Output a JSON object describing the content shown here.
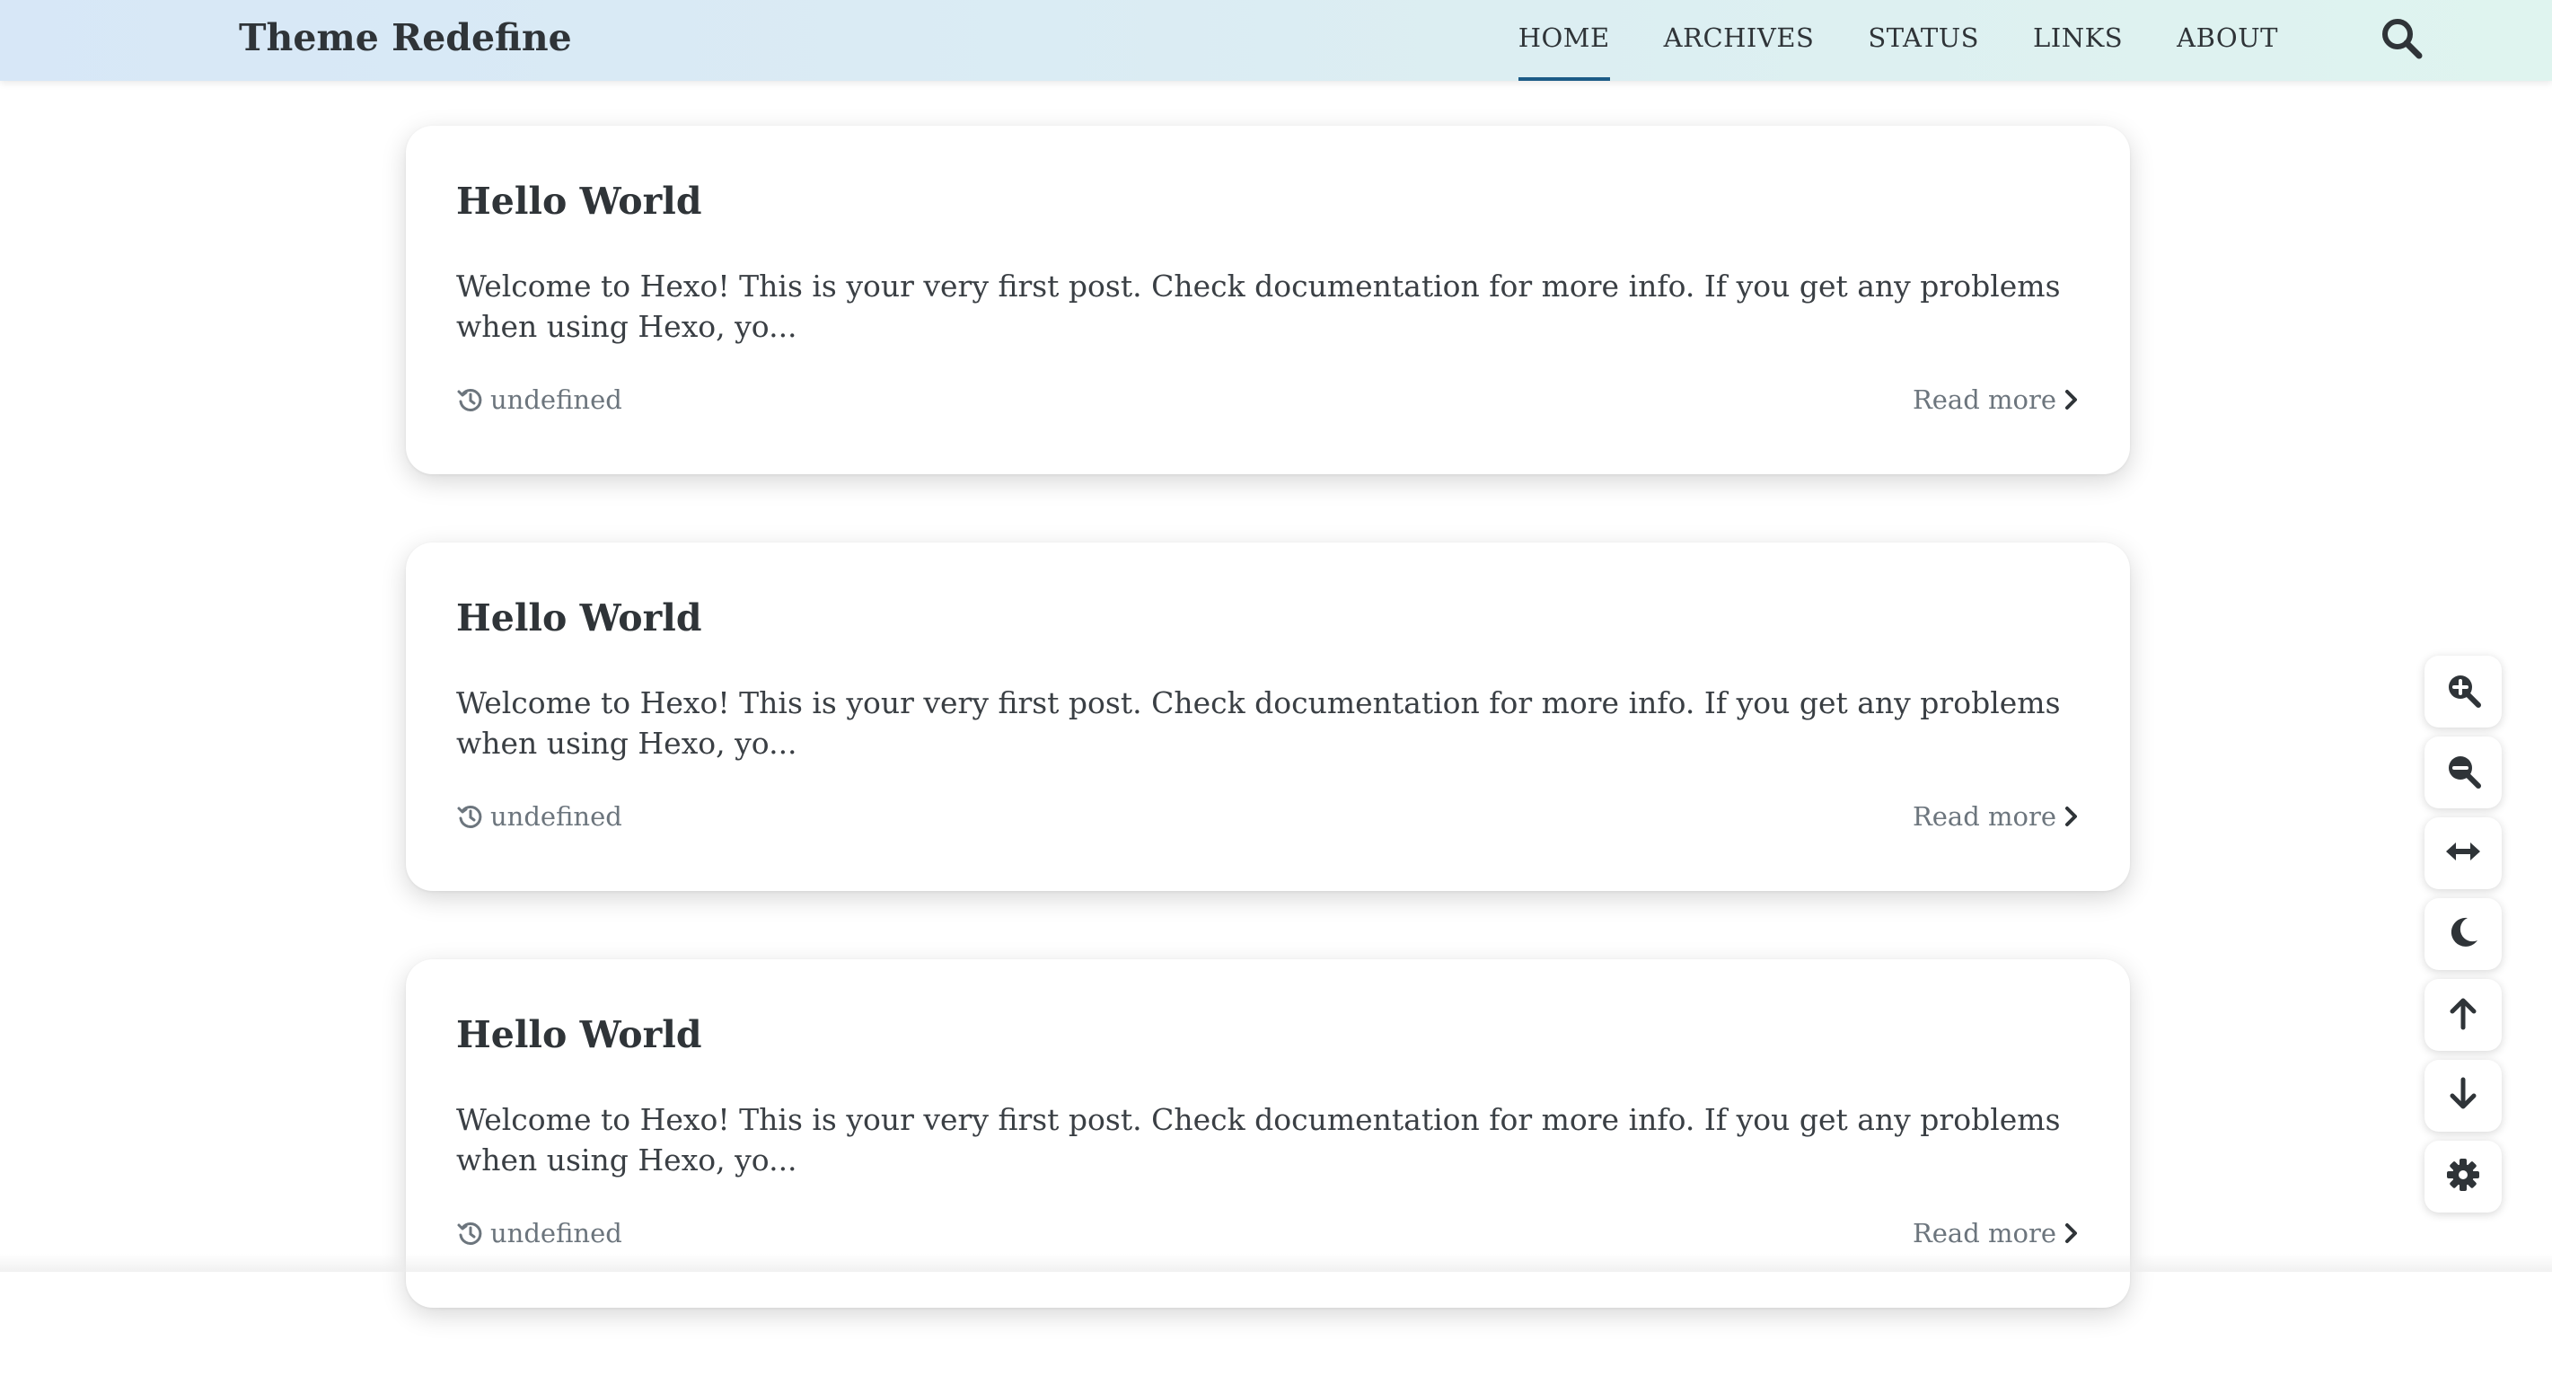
{
  "site": {
    "title": "Theme Redefine"
  },
  "nav": {
    "items": [
      {
        "label": "HOME",
        "active": true
      },
      {
        "label": "ARCHIVES",
        "active": false
      },
      {
        "label": "STATUS",
        "active": false
      },
      {
        "label": "LINKS",
        "active": false
      },
      {
        "label": "ABOUT",
        "active": false
      }
    ],
    "search_icon": "search-icon",
    "active_color": "#1b5b87"
  },
  "posts": [
    {
      "title": "Hello World",
      "excerpt": "Welcome to Hexo! This is your very first post. Check documentation for more info. If you get any problems when using Hexo, yo...",
      "date": "undefined",
      "date_icon": "history-icon",
      "read_more": "Read more",
      "read_more_icon": "chevron-right-icon"
    },
    {
      "title": "Hello World",
      "excerpt": "Welcome to Hexo! This is your very first post. Check documentation for more info. If you get any problems when using Hexo, yo...",
      "date": "undefined",
      "date_icon": "history-icon",
      "read_more": "Read more",
      "read_more_icon": "chevron-right-icon"
    },
    {
      "title": "Hello World",
      "excerpt": "Welcome to Hexo! This is your very first post. Check documentation for more info. If you get any problems when using Hexo, yo...",
      "date": "undefined",
      "date_icon": "history-icon",
      "read_more": "Read more",
      "read_more_icon": "chevron-right-icon"
    }
  ],
  "side_tools": [
    {
      "icon": "zoom-in-icon"
    },
    {
      "icon": "zoom-out-icon"
    },
    {
      "icon": "expand-width-icon"
    },
    {
      "icon": "dark-mode-moon-icon"
    },
    {
      "icon": "arrow-up-icon"
    },
    {
      "icon": "arrow-down-icon"
    },
    {
      "icon": "settings-gear-icon"
    }
  ],
  "colors": {
    "navbar_gradient_start": "#d7e7f7",
    "navbar_gradient_end": "#dff4ef",
    "text_primary": "#2f3438",
    "text_muted": "#6c757d"
  }
}
